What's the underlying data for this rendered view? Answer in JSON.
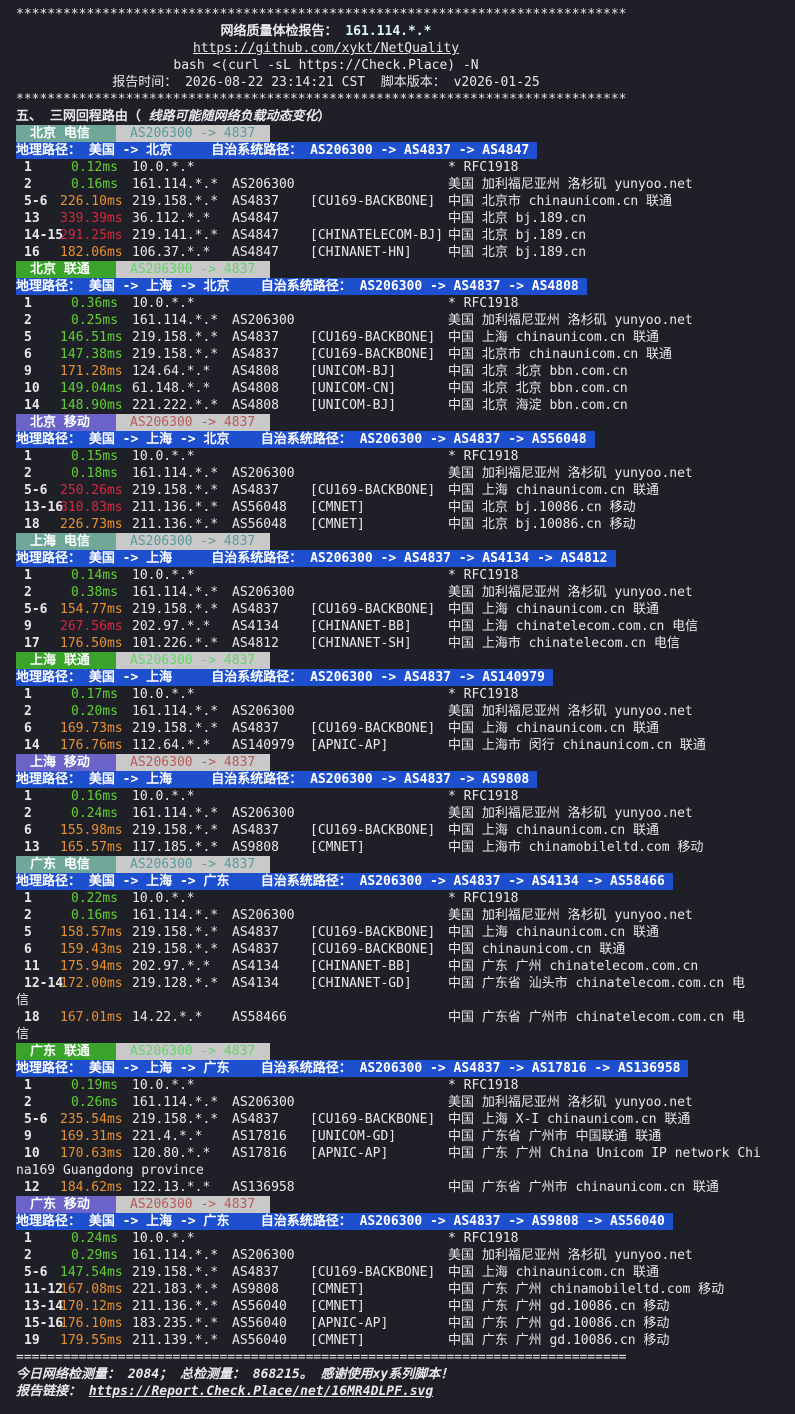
{
  "header": {
    "stars": "******************************************************************************",
    "title_prefix": "网络质量体检报告： ",
    "title_ip": "161.114.*.*",
    "url": "https://github.com/xykt/NetQuality",
    "cmd": "bash <(curl -sL https://Check.Place) -N",
    "time_line": "报告时间： 2026-08-22 23:14:21 CST  脚本版本： v2026-01-25"
  },
  "section": {
    "title": "五、 三网回程路由（",
    "note": " 线路可能随网络负载动态变化",
    "close": "）"
  },
  "colors": {
    "rtt_green": "#5fd12e",
    "rtt_orange": "#e8912e",
    "rtt_red": "#d9273b",
    "telecom_label_bg": "#6fa898",
    "unicom_label_bg": "#3aa32b",
    "mobile_label_bg": "#6b63c7",
    "telecom_as_fg": "#5a9a9a",
    "unicom_as_fg": "#63d46a",
    "mobile_as_fg": "#b75a5a",
    "geo_bg": "#1e4fcf"
  },
  "routes": [
    {
      "label": "北京 电信",
      "as": "AS206300 -> 4837",
      "kind": "telecom",
      "geo": "地理路径： 美国 -> 北京     自治系统路径： AS206300 -> AS4837 -> AS4847",
      "hops": [
        {
          "n": "1",
          "rtt": "0.12ms",
          "c": "green",
          "ip": "10.0.*.*",
          "asn": "",
          "tag": "",
          "loc": "* RFC1918"
        },
        {
          "n": "2",
          "rtt": "0.16ms",
          "c": "green",
          "ip": "161.114.*.*",
          "asn": "AS206300",
          "tag": "",
          "loc": "美国 加利福尼亚州 洛杉矶 yunyoo.net"
        },
        {
          "n": "5-6",
          "rtt": "226.10ms",
          "c": "orange",
          "ip": "219.158.*.*",
          "asn": "AS4837",
          "tag": "[CU169-BACKBONE]",
          "loc": "中国 北京市 chinaunicom.cn 联通"
        },
        {
          "n": "13",
          "rtt": "339.39ms",
          "c": "red",
          "ip": "36.112.*.*",
          "asn": "AS4847",
          "tag": "",
          "loc": "中国 北京 bj.189.cn"
        },
        {
          "n": "14-15",
          "rtt": "291.25ms",
          "c": "red",
          "ip": "219.141.*.*",
          "asn": "AS4847",
          "tag": "[CHINATELECOM-BJ]",
          "loc": "中国 北京 bj.189.cn"
        },
        {
          "n": "16",
          "rtt": "182.06ms",
          "c": "orange",
          "ip": "106.37.*.*",
          "asn": "AS4847",
          "tag": "[CHINANET-HN]",
          "loc": "中国 北京 bj.189.cn"
        }
      ]
    },
    {
      "label": "北京 联通",
      "as": "AS206300 -> 4837",
      "kind": "unicom",
      "geo": "地理路径： 美国 -> 上海 -> 北京    自治系统路径： AS206300 -> AS4837 -> AS4808",
      "hops": [
        {
          "n": "1",
          "rtt": "0.36ms",
          "c": "green",
          "ip": "10.0.*.*",
          "asn": "",
          "tag": "",
          "loc": "* RFC1918"
        },
        {
          "n": "2",
          "rtt": "0.25ms",
          "c": "green",
          "ip": "161.114.*.*",
          "asn": "AS206300",
          "tag": "",
          "loc": "美国 加利福尼亚州 洛杉矶 yunyoo.net"
        },
        {
          "n": "5",
          "rtt": "146.51ms",
          "c": "green",
          "ip": "219.158.*.*",
          "asn": "AS4837",
          "tag": "[CU169-BACKBONE]",
          "loc": "中国 上海 chinaunicom.cn 联通"
        },
        {
          "n": "6",
          "rtt": "147.38ms",
          "c": "green",
          "ip": "219.158.*.*",
          "asn": "AS4837",
          "tag": "[CU169-BACKBONE]",
          "loc": "中国 北京市 chinaunicom.cn 联通"
        },
        {
          "n": "9",
          "rtt": "171.28ms",
          "c": "orange",
          "ip": "124.64.*.*",
          "asn": "AS4808",
          "tag": "[UNICOM-BJ]",
          "loc": "中国 北京 北京 bbn.com.cn"
        },
        {
          "n": "10",
          "rtt": "149.04ms",
          "c": "green",
          "ip": "61.148.*.*",
          "asn": "AS4808",
          "tag": "[UNICOM-CN]",
          "loc": "中国 北京 北京 bbn.com.cn"
        },
        {
          "n": "14",
          "rtt": "148.90ms",
          "c": "green",
          "ip": "221.222.*.*",
          "asn": "AS4808",
          "tag": "[UNICOM-BJ]",
          "loc": "中国 北京 海淀 bbn.com.cn"
        }
      ]
    },
    {
      "label": "北京 移动",
      "as": "AS206300 -> 4837",
      "kind": "mobile",
      "geo": "地理路径： 美国 -> 上海 -> 北京    自治系统路径： AS206300 -> AS4837 -> AS56048",
      "hops": [
        {
          "n": "1",
          "rtt": "0.15ms",
          "c": "green",
          "ip": "10.0.*.*",
          "asn": "",
          "tag": "",
          "loc": "* RFC1918"
        },
        {
          "n": "2",
          "rtt": "0.18ms",
          "c": "green",
          "ip": "161.114.*.*",
          "asn": "AS206300",
          "tag": "",
          "loc": "美国 加利福尼亚州 洛杉矶 yunyoo.net"
        },
        {
          "n": "5-6",
          "rtt": "250.26ms",
          "c": "red",
          "ip": "219.158.*.*",
          "asn": "AS4837",
          "tag": "[CU169-BACKBONE]",
          "loc": "中国 上海 chinaunicom.cn 联通"
        },
        {
          "n": "13-16",
          "rtt": "310.83ms",
          "c": "red",
          "ip": "211.136.*.*",
          "asn": "AS56048",
          "tag": "[CMNET]",
          "loc": "中国 北京 bj.10086.cn 移动"
        },
        {
          "n": "18",
          "rtt": "226.73ms",
          "c": "orange",
          "ip": "211.136.*.*",
          "asn": "AS56048",
          "tag": "[CMNET]",
          "loc": "中国 北京 bj.10086.cn 移动"
        }
      ]
    },
    {
      "label": "上海 电信",
      "as": "AS206300 -> 4837",
      "kind": "telecom",
      "geo": "地理路径： 美国 -> 上海     自治系统路径： AS206300 -> AS4837 -> AS4134 -> AS4812",
      "hops": [
        {
          "n": "1",
          "rtt": "0.14ms",
          "c": "green",
          "ip": "10.0.*.*",
          "asn": "",
          "tag": "",
          "loc": "* RFC1918"
        },
        {
          "n": "2",
          "rtt": "0.38ms",
          "c": "green",
          "ip": "161.114.*.*",
          "asn": "AS206300",
          "tag": "",
          "loc": "美国 加利福尼亚州 洛杉矶 yunyoo.net"
        },
        {
          "n": "5-6",
          "rtt": "154.77ms",
          "c": "orange",
          "ip": "219.158.*.*",
          "asn": "AS4837",
          "tag": "[CU169-BACKBONE]",
          "loc": "中国 上海 chinaunicom.cn 联通"
        },
        {
          "n": "9",
          "rtt": "267.56ms",
          "c": "red",
          "ip": "202.97.*.*",
          "asn": "AS4134",
          "tag": "[CHINANET-BB]",
          "loc": "中国 上海 chinatelecom.com.cn 电信"
        },
        {
          "n": "17",
          "rtt": "176.50ms",
          "c": "orange",
          "ip": "101.226.*.*",
          "asn": "AS4812",
          "tag": "[CHINANET-SH]",
          "loc": "中国 上海市 chinatelecom.cn 电信"
        }
      ]
    },
    {
      "label": "上海 联通",
      "as": "AS206300 -> 4837",
      "kind": "unicom",
      "geo": "地理路径： 美国 -> 上海     自治系统路径： AS206300 -> AS4837 -> AS140979",
      "hops": [
        {
          "n": "1",
          "rtt": "0.17ms",
          "c": "green",
          "ip": "10.0.*.*",
          "asn": "",
          "tag": "",
          "loc": "* RFC1918"
        },
        {
          "n": "2",
          "rtt": "0.20ms",
          "c": "green",
          "ip": "161.114.*.*",
          "asn": "AS206300",
          "tag": "",
          "loc": "美国 加利福尼亚州 洛杉矶 yunyoo.net"
        },
        {
          "n": "6",
          "rtt": "169.73ms",
          "c": "orange",
          "ip": "219.158.*.*",
          "asn": "AS4837",
          "tag": "[CU169-BACKBONE]",
          "loc": "中国 上海 chinaunicom.cn 联通"
        },
        {
          "n": "14",
          "rtt": "176.76ms",
          "c": "orange",
          "ip": "112.64.*.*",
          "asn": "AS140979",
          "tag": "[APNIC-AP]",
          "loc": "中国 上海市 闵行 chinaunicom.cn 联通"
        }
      ]
    },
    {
      "label": "上海 移动",
      "as": "AS206300 -> 4837",
      "kind": "mobile",
      "geo": "地理路径： 美国 -> 上海     自治系统路径： AS206300 -> AS4837 -> AS9808",
      "hops": [
        {
          "n": "1",
          "rtt": "0.16ms",
          "c": "green",
          "ip": "10.0.*.*",
          "asn": "",
          "tag": "",
          "loc": "* RFC1918"
        },
        {
          "n": "2",
          "rtt": "0.24ms",
          "c": "green",
          "ip": "161.114.*.*",
          "asn": "AS206300",
          "tag": "",
          "loc": "美国 加利福尼亚州 洛杉矶 yunyoo.net"
        },
        {
          "n": "6",
          "rtt": "155.98ms",
          "c": "orange",
          "ip": "219.158.*.*",
          "asn": "AS4837",
          "tag": "[CU169-BACKBONE]",
          "loc": "中国 上海 chinaunicom.cn 联通"
        },
        {
          "n": "13",
          "rtt": "165.57ms",
          "c": "orange",
          "ip": "117.185.*.*",
          "asn": "AS9808",
          "tag": "[CMNET]",
          "loc": "中国 上海市 chinamobileltd.com 移动"
        }
      ]
    },
    {
      "label": "广东 电信",
      "as": "AS206300 -> 4837",
      "kind": "telecom",
      "geo": "地理路径： 美国 -> 上海 -> 广东    自治系统路径： AS206300 -> AS4837 -> AS4134 -> AS58466",
      "hops": [
        {
          "n": "1",
          "rtt": "0.22ms",
          "c": "green",
          "ip": "10.0.*.*",
          "asn": "",
          "tag": "",
          "loc": "* RFC1918"
        },
        {
          "n": "2",
          "rtt": "0.16ms",
          "c": "green",
          "ip": "161.114.*.*",
          "asn": "AS206300",
          "tag": "",
          "loc": "美国 加利福尼亚州 洛杉矶 yunyoo.net"
        },
        {
          "n": "5",
          "rtt": "158.57ms",
          "c": "orange",
          "ip": "219.158.*.*",
          "asn": "AS4837",
          "tag": "[CU169-BACKBONE]",
          "loc": "中国 上海 chinaunicom.cn 联通"
        },
        {
          "n": "6",
          "rtt": "159.43ms",
          "c": "orange",
          "ip": "219.158.*.*",
          "asn": "AS4837",
          "tag": "[CU169-BACKBONE]",
          "loc": "中国 chinaunicom.cn 联通"
        },
        {
          "n": "11",
          "rtt": "175.94ms",
          "c": "orange",
          "ip": "202.97.*.*",
          "asn": "AS4134",
          "tag": "[CHINANET-BB]",
          "loc": "中国 广东 广州 chinatelecom.com.cn"
        },
        {
          "n": "12-14",
          "rtt": "172.00ms",
          "c": "orange",
          "ip": "219.128.*.*",
          "asn": "AS4134",
          "tag": "[CHINANET-GD]",
          "loc": "中国 广东省 汕头市 chinatelecom.com.cn 电",
          "wrap": "信"
        },
        {
          "n": "18",
          "rtt": "167.01ms",
          "c": "orange",
          "ip": "14.22.*.*",
          "asn": "AS58466",
          "tag": "",
          "loc": "中国 广东省 广州市 chinatelecom.com.cn 电",
          "wrap": "信"
        }
      ]
    },
    {
      "label": "广东 联通",
      "as": "AS206300 -> 4837",
      "kind": "unicom",
      "geo": "地理路径： 美国 -> 上海 -> 广东    自治系统路径： AS206300 -> AS4837 -> AS17816 -> AS136958",
      "hops": [
        {
          "n": "1",
          "rtt": "0.19ms",
          "c": "green",
          "ip": "10.0.*.*",
          "asn": "",
          "tag": "",
          "loc": "* RFC1918"
        },
        {
          "n": "2",
          "rtt": "0.26ms",
          "c": "green",
          "ip": "161.114.*.*",
          "asn": "AS206300",
          "tag": "",
          "loc": "美国 加利福尼亚州 洛杉矶 yunyoo.net"
        },
        {
          "n": "5-6",
          "rtt": "235.54ms",
          "c": "orange",
          "ip": "219.158.*.*",
          "asn": "AS4837",
          "tag": "[CU169-BACKBONE]",
          "loc": "中国 上海 X-I chinaunicom.cn 联通"
        },
        {
          "n": "9",
          "rtt": "169.31ms",
          "c": "orange",
          "ip": "221.4.*.*",
          "asn": "AS17816",
          "tag": "[UNICOM-GD]",
          "loc": "中国 广东省 广州市 中国联通 联通"
        },
        {
          "n": "10",
          "rtt": "170.63ms",
          "c": "orange",
          "ip": "120.80.*.*",
          "asn": "AS17816",
          "tag": "[APNIC-AP]",
          "loc": "中国 广东 广州 China Unicom IP network Chi",
          "wrap": "na169 Guangdong province"
        },
        {
          "n": "12",
          "rtt": "184.62ms",
          "c": "orange",
          "ip": "122.13.*.*",
          "asn": "AS136958",
          "tag": "",
          "loc": "中国 广东省 广州市 chinaunicom.cn 联通"
        }
      ]
    },
    {
      "label": "广东 移动",
      "as": "AS206300 -> 4837",
      "kind": "mobile",
      "geo": "地理路径： 美国 -> 上海 -> 广东    自治系统路径： AS206300 -> AS4837 -> AS9808 -> AS56040",
      "hops": [
        {
          "n": "1",
          "rtt": "0.24ms",
          "c": "green",
          "ip": "10.0.*.*",
          "asn": "",
          "tag": "",
          "loc": "* RFC1918"
        },
        {
          "n": "2",
          "rtt": "0.29ms",
          "c": "green",
          "ip": "161.114.*.*",
          "asn": "AS206300",
          "tag": "",
          "loc": "美国 加利福尼亚州 洛杉矶 yunyoo.net"
        },
        {
          "n": "5-6",
          "rtt": "147.54ms",
          "c": "green",
          "ip": "219.158.*.*",
          "asn": "AS4837",
          "tag": "[CU169-BACKBONE]",
          "loc": "中国 上海 chinaunicom.cn 联通"
        },
        {
          "n": "11-12",
          "rtt": "167.08ms",
          "c": "orange",
          "ip": "221.183.*.*",
          "asn": "AS9808",
          "tag": "[CMNET]",
          "loc": "中国 广东 广州 chinamobileltd.com 移动"
        },
        {
          "n": "13-14",
          "rtt": "170.12ms",
          "c": "orange",
          "ip": "211.136.*.*",
          "asn": "AS56040",
          "tag": "[CMNET]",
          "loc": "中国 广东 广州 gd.10086.cn 移动"
        },
        {
          "n": "15-16",
          "rtt": "176.10ms",
          "c": "orange",
          "ip": "183.235.*.*",
          "asn": "AS56040",
          "tag": "[APNIC-AP]",
          "loc": "中国 广东 广州 gd.10086.cn 移动"
        },
        {
          "n": "19",
          "rtt": "179.55ms",
          "c": "orange",
          "ip": "211.139.*.*",
          "asn": "AS56040",
          "tag": "[CMNET]",
          "loc": "中国 广东 广州 gd.10086.cn 移动"
        }
      ]
    }
  ],
  "footer": {
    "rule": "==============================================================================",
    "stats": "今日网络检测量： 2084； 总检测量： 868215。 感谢使用xy系列脚本！",
    "link_label": "报告链接： ",
    "link": "https://Report.Check.Place/net/16MR4DLPF.svg"
  }
}
